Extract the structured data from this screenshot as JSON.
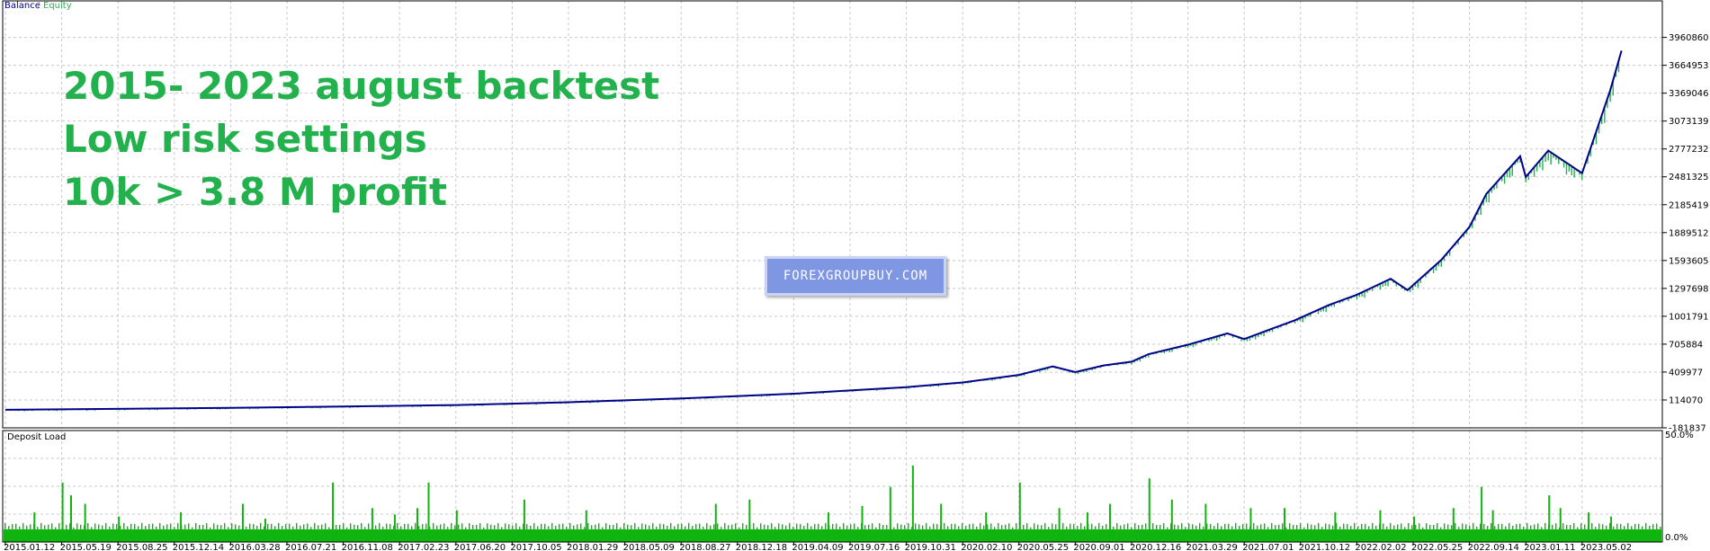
{
  "chart_data": [
    {
      "type": "line",
      "title": "",
      "legend": [
        "Balance",
        "Equity"
      ],
      "legend_separator": "/",
      "legend_position": "top-left",
      "colors": {
        "Balance": "#00008b",
        "Equity": "#22b14c"
      },
      "y_ticks": [
        "3960860",
        "3664953",
        "3369046",
        "3073139",
        "2777232",
        "2481325",
        "2185419",
        "1889512",
        "1593605",
        "1297698",
        "1001791",
        "705884",
        "409977",
        "114070",
        "-181837"
      ],
      "ylim": [
        -181837,
        4100000
      ],
      "x_ticks": [
        "2015.01.12",
        "2015.05.19",
        "2015.08.25",
        "2015.12.14",
        "2016.03.28",
        "2016.07.21",
        "2016.11.08",
        "2017.02.23",
        "2017.06.20",
        "2017.10.05",
        "2018.01.29",
        "2018.05.09",
        "2018.08.27",
        "2018.12.18",
        "2019.04.09",
        "2019.07.16",
        "2019.10.31",
        "2020.02.10",
        "2020.05.25",
        "2020.09.01",
        "2020.12.16",
        "2021.03.29",
        "2021.07.01",
        "2021.10.12",
        "2022.02.02",
        "2022.05.25",
        "2022.09.14",
        "2023.01.11",
        "2023.05.02"
      ],
      "grid": true,
      "series": [
        {
          "name": "Balance",
          "x": [
            0,
            4,
            8,
            10,
            12,
            14,
            16,
            17,
            18,
            18.6,
            19,
            19.5,
            20,
            20.3,
            21,
            21.7,
            22,
            22.4,
            22.9,
            23.5,
            24,
            24.6,
            24.9,
            25.5,
            26,
            26.3,
            26.9,
            27,
            27.4,
            28,
            28.5,
            28.7
          ],
          "values": [
            10000,
            30000,
            60000,
            90000,
            130000,
            180000,
            250000,
            300000,
            380000,
            470000,
            410000,
            480000,
            520000,
            600000,
            700000,
            820000,
            760000,
            850000,
            960000,
            1120000,
            1230000,
            1400000,
            1280000,
            1600000,
            1950000,
            2300000,
            2700000,
            2480000,
            2760000,
            2520000,
            3400000,
            3820000
          ]
        }
      ]
    },
    {
      "type": "bar",
      "title": "Deposit Load",
      "y_ticks": [
        "50.0%",
        "0.0%"
      ],
      "ylim": [
        0,
        50
      ],
      "x_ticks": [
        "2015.01.12",
        "2015.05.19",
        "2015.08.25",
        "2015.12.14",
        "2016.03.28",
        "2016.07.21",
        "2016.11.08",
        "2017.02.23",
        "2017.06.20",
        "2017.10.05",
        "2018.01.29",
        "2018.05.09",
        "2018.08.27",
        "2018.12.18",
        "2019.04.09",
        "2019.07.16",
        "2019.10.31",
        "2020.02.10",
        "2020.05.25",
        "2020.09.01",
        "2020.12.16",
        "2021.03.29",
        "2021.07.01",
        "2021.10.12",
        "2022.02.02",
        "2022.05.25",
        "2022.09.14",
        "2023.01.11",
        "2023.05.02"
      ],
      "baseline_level": 6,
      "color": "#0fb40f",
      "spikes": [
        {
          "x": 0.5,
          "value": 14
        },
        {
          "x": 1.0,
          "value": 28
        },
        {
          "x": 1.15,
          "value": 22
        },
        {
          "x": 1.4,
          "value": 18
        },
        {
          "x": 2.0,
          "value": 12
        },
        {
          "x": 3.1,
          "value": 14
        },
        {
          "x": 4.2,
          "value": 18
        },
        {
          "x": 4.6,
          "value": 11
        },
        {
          "x": 5.8,
          "value": 28
        },
        {
          "x": 6.5,
          "value": 16
        },
        {
          "x": 6.9,
          "value": 13
        },
        {
          "x": 7.3,
          "value": 16
        },
        {
          "x": 7.5,
          "value": 28
        },
        {
          "x": 8.0,
          "value": 15
        },
        {
          "x": 9.2,
          "value": 20
        },
        {
          "x": 10.3,
          "value": 15
        },
        {
          "x": 12.6,
          "value": 18
        },
        {
          "x": 13.2,
          "value": 20
        },
        {
          "x": 14.6,
          "value": 14
        },
        {
          "x": 15.2,
          "value": 17
        },
        {
          "x": 15.7,
          "value": 26
        },
        {
          "x": 16.1,
          "value": 36
        },
        {
          "x": 16.6,
          "value": 18
        },
        {
          "x": 17.4,
          "value": 14
        },
        {
          "x": 18.0,
          "value": 28
        },
        {
          "x": 18.7,
          "value": 16
        },
        {
          "x": 19.2,
          "value": 14
        },
        {
          "x": 19.6,
          "value": 18
        },
        {
          "x": 20.3,
          "value": 30
        },
        {
          "x": 20.7,
          "value": 20
        },
        {
          "x": 21.3,
          "value": 18
        },
        {
          "x": 22.1,
          "value": 16
        },
        {
          "x": 22.7,
          "value": 16
        },
        {
          "x": 23.6,
          "value": 14
        },
        {
          "x": 24.4,
          "value": 15
        },
        {
          "x": 25.0,
          "value": 12
        },
        {
          "x": 25.7,
          "value": 16
        },
        {
          "x": 26.2,
          "value": 26
        },
        {
          "x": 26.4,
          "value": 15
        },
        {
          "x": 27.4,
          "value": 22
        },
        {
          "x": 27.6,
          "value": 16
        },
        {
          "x": 28.1,
          "value": 14
        },
        {
          "x": 28.5,
          "value": 12
        }
      ]
    }
  ],
  "annotation": {
    "line1": "2015- 2023 august backtest",
    "line2": "Low risk settings",
    "line3": "10k > 3.8 M profit"
  },
  "watermark": "FOREXGROUPBUY.COM"
}
